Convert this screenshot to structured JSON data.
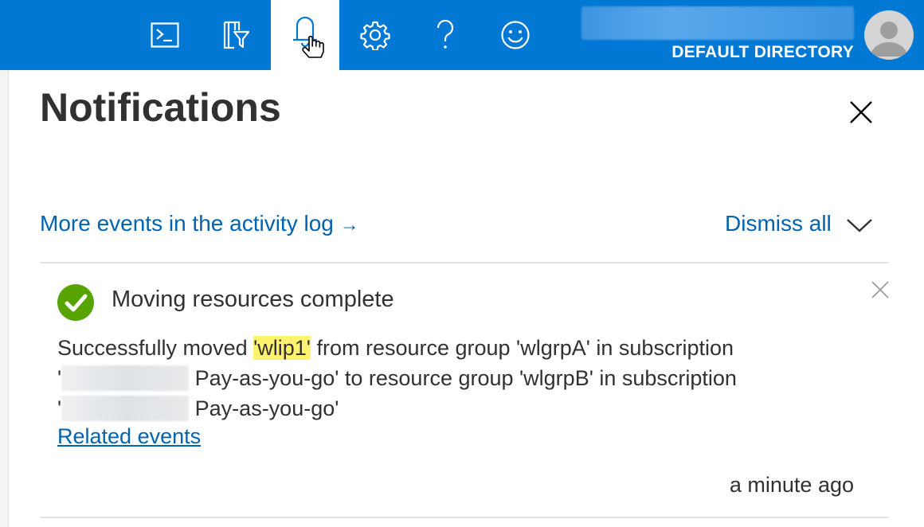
{
  "topbar": {
    "icons": [
      "cloud-shell-icon",
      "directory-filter-icon",
      "bell-icon",
      "gear-icon",
      "help-icon",
      "feedback-smiley-icon"
    ],
    "directory_label": "DEFAULT DIRECTORY",
    "colors": {
      "background": "#0078d4",
      "active_tab": "#ffffff"
    }
  },
  "panel": {
    "title": "Notifications",
    "activity_log_link": "More events in the activity log",
    "activity_log_arrow": "→",
    "dismiss_all": "Dismiss all"
  },
  "notification": {
    "title": "Moving resources complete",
    "status": "success",
    "status_color": "#57a300",
    "body": {
      "part1": "Successfully moved ",
      "resource": "'wlip1'",
      "part2": " from resource group 'wlgrpA' in subscription",
      "line2_start": "'",
      "line2_end": " Pay-as-you-go' to resource group 'wlgrpB' in subscription",
      "line3_start": "'",
      "line3_end": " Pay-as-you-go'"
    },
    "related_link": "Related events",
    "timestamp": "a minute ago"
  },
  "colors": {
    "link": "#0063b1",
    "highlight": "#fff36e",
    "text": "#323130"
  }
}
